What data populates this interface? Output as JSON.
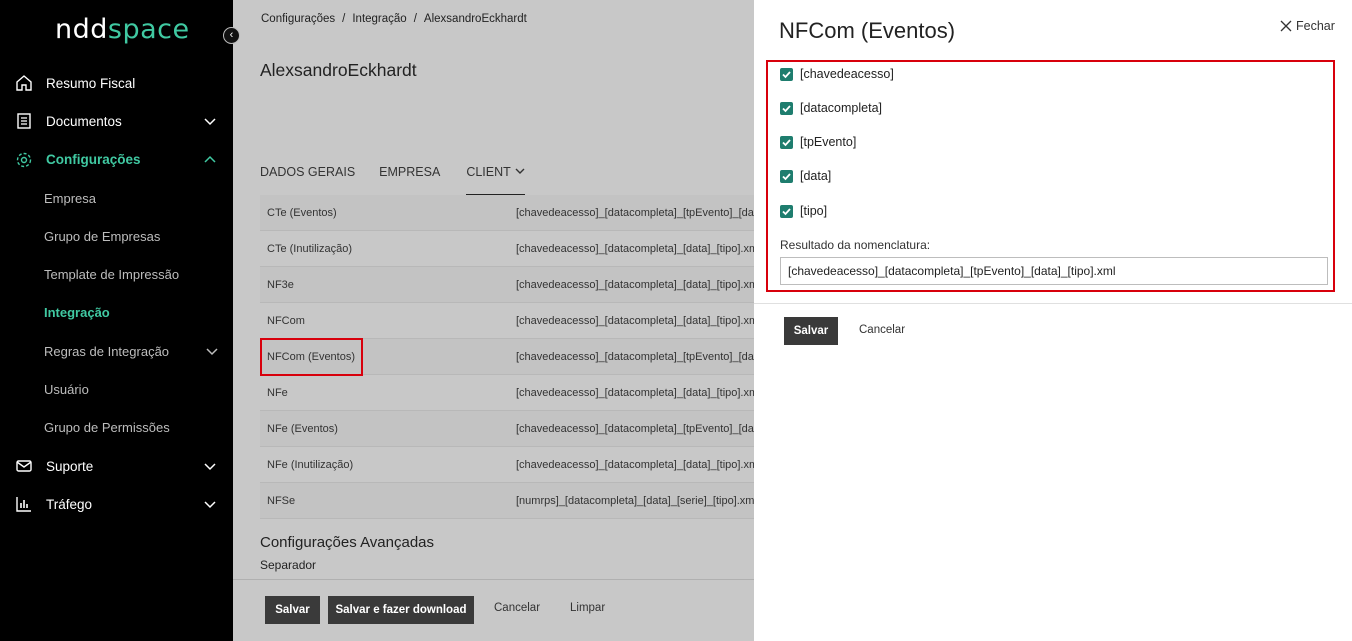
{
  "sidebar": {
    "logo_main": "ndd",
    "logo_accent": "space",
    "items": [
      {
        "label": "Resumo Fiscal"
      },
      {
        "label": "Documentos"
      },
      {
        "label": "Configurações"
      }
    ],
    "sub_items": [
      {
        "label": "Empresa"
      },
      {
        "label": "Grupo de Empresas"
      },
      {
        "label": "Template de Impressão"
      },
      {
        "label": "Integração"
      },
      {
        "label": "Regras de Integração"
      },
      {
        "label": "Usuário"
      },
      {
        "label": "Grupo de Permissões"
      }
    ],
    "bottom_items": [
      {
        "label": "Suporte"
      },
      {
        "label": "Tráfego"
      }
    ]
  },
  "breadcrumb": [
    "Configurações",
    "Integração",
    "AlexsandroEckhardt"
  ],
  "page_title": "AlexsandroEckhardt",
  "tabs": [
    {
      "label": "DADOS GERAIS"
    },
    {
      "label": "EMPRESA"
    },
    {
      "label": "CLIENT"
    }
  ],
  "table_rows": [
    {
      "name": "CTe (Eventos)",
      "pattern": "[chavedeacesso]_[datacompleta]_[tpEvento]_[data]_[tipo].xml"
    },
    {
      "name": "CTe (Inutilização)",
      "pattern": "[chavedeacesso]_[datacompleta]_[data]_[tipo].xml"
    },
    {
      "name": "NF3e",
      "pattern": "[chavedeacesso]_[datacompleta]_[data]_[tipo].xml"
    },
    {
      "name": "NFCom",
      "pattern": "[chavedeacesso]_[datacompleta]_[data]_[tipo].xml"
    },
    {
      "name": "NFCom (Eventos)",
      "pattern": "[chavedeacesso]_[datacompleta]_[tpEvento]_[data]_[tipo].xml"
    },
    {
      "name": "NFe",
      "pattern": "[chavedeacesso]_[datacompleta]_[data]_[tipo].xml"
    },
    {
      "name": "NFe (Eventos)",
      "pattern": "[chavedeacesso]_[datacompleta]_[tpEvento]_[data]_[tipo].xml"
    },
    {
      "name": "NFe (Inutilização)",
      "pattern": "[chavedeacesso]_[datacompleta]_[data]_[tipo].xml"
    },
    {
      "name": "NFSe",
      "pattern": "[numrps]_[datacompleta]_[data]_[serie]_[tipo].xml"
    }
  ],
  "advanced": {
    "title": "Configurações Avançadas",
    "separator_label": "Separador"
  },
  "footer": {
    "save": "Salvar",
    "save_download": "Salvar e fazer download",
    "cancel": "Cancelar",
    "clear": "Limpar"
  },
  "panel": {
    "title": "NFCom (Eventos)",
    "close_label": "Fechar",
    "checkboxes": [
      {
        "label": "[chavedeacesso]",
        "checked": true
      },
      {
        "label": "[datacompleta]",
        "checked": true
      },
      {
        "label": "[tpEvento]",
        "checked": true
      },
      {
        "label": "[data]",
        "checked": true
      },
      {
        "label": "[tipo]",
        "checked": true
      }
    ],
    "result_label": "Resultado da nomenclatura:",
    "result_value": "[chavedeacesso]_[datacompleta]_[tpEvento]_[data]_[tipo].xml",
    "save": "Salvar",
    "cancel": "Cancelar"
  },
  "colors": {
    "accent": "#40c9a2",
    "checkbox": "#1e7d6e",
    "highlight": "#d8000c"
  }
}
